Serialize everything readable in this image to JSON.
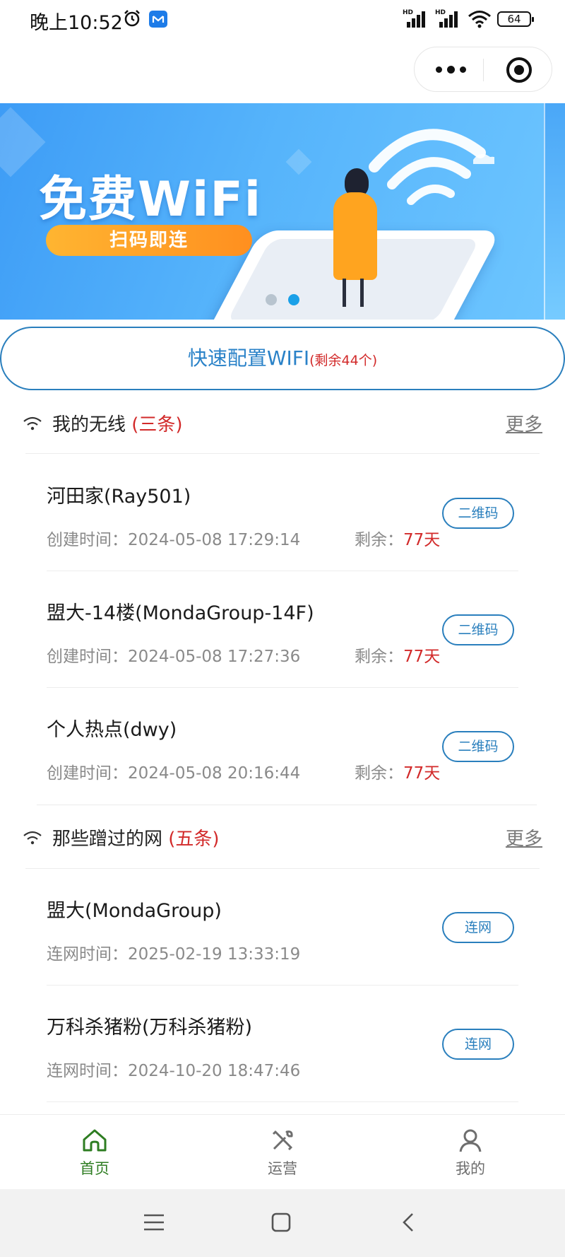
{
  "status_bar": {
    "time": "晚上10:52",
    "signal_1_label": "HD",
    "signal_2_label": "HD",
    "battery": "64"
  },
  "banner": {
    "title": "免费WiFi",
    "subtitle": "扫码即连",
    "active_dot": 1
  },
  "quick_config": {
    "label": "快速配置WIFI",
    "remaining": "(剩余44个)"
  },
  "my_wireless": {
    "title": "我的无线",
    "count": "(三条)",
    "more": "更多",
    "items": [
      {
        "name": "河田家(Ray501)",
        "created_label": "创建时间：",
        "created": "2024-05-08 17:29:14",
        "remain_label": "剩余：",
        "remain": "77天",
        "button": "二维码"
      },
      {
        "name": "盟大-14楼(MondaGroup-14F)",
        "created_label": "创建时间：",
        "created": "2024-05-08 17:27:36",
        "remain_label": "剩余：",
        "remain": "77天",
        "button": "二维码"
      },
      {
        "name": "个人热点(dwy)",
        "created_label": "创建时间：",
        "created": "2024-05-08 20:16:44",
        "remain_label": "剩余：",
        "remain": "77天",
        "button": "二维码"
      }
    ]
  },
  "visited_networks": {
    "title": "那些蹭过的网",
    "count": "(五条)",
    "more": "更多",
    "items": [
      {
        "name": "盟大(MondaGroup)",
        "connected_label": "连网时间：",
        "connected": "2025-02-19 13:33:19",
        "button": "连网"
      },
      {
        "name": "万科杀猪粉(万科杀猪粉)",
        "connected_label": "连网时间：",
        "connected": "2024-10-20 18:47:46",
        "button": "连网"
      }
    ]
  },
  "tabbar": {
    "tabs": [
      {
        "label": "首页",
        "icon": "home-icon",
        "active": true
      },
      {
        "label": "运营",
        "icon": "tools-icon",
        "active": false
      },
      {
        "label": "我的",
        "icon": "user-icon",
        "active": false
      }
    ]
  },
  "colors": {
    "accent_blue": "#2a7fbd",
    "highlight_red": "#d22a2a",
    "active_tab_green": "#2e7d22",
    "inactive_tab_gray": "#6e6e6e"
  }
}
